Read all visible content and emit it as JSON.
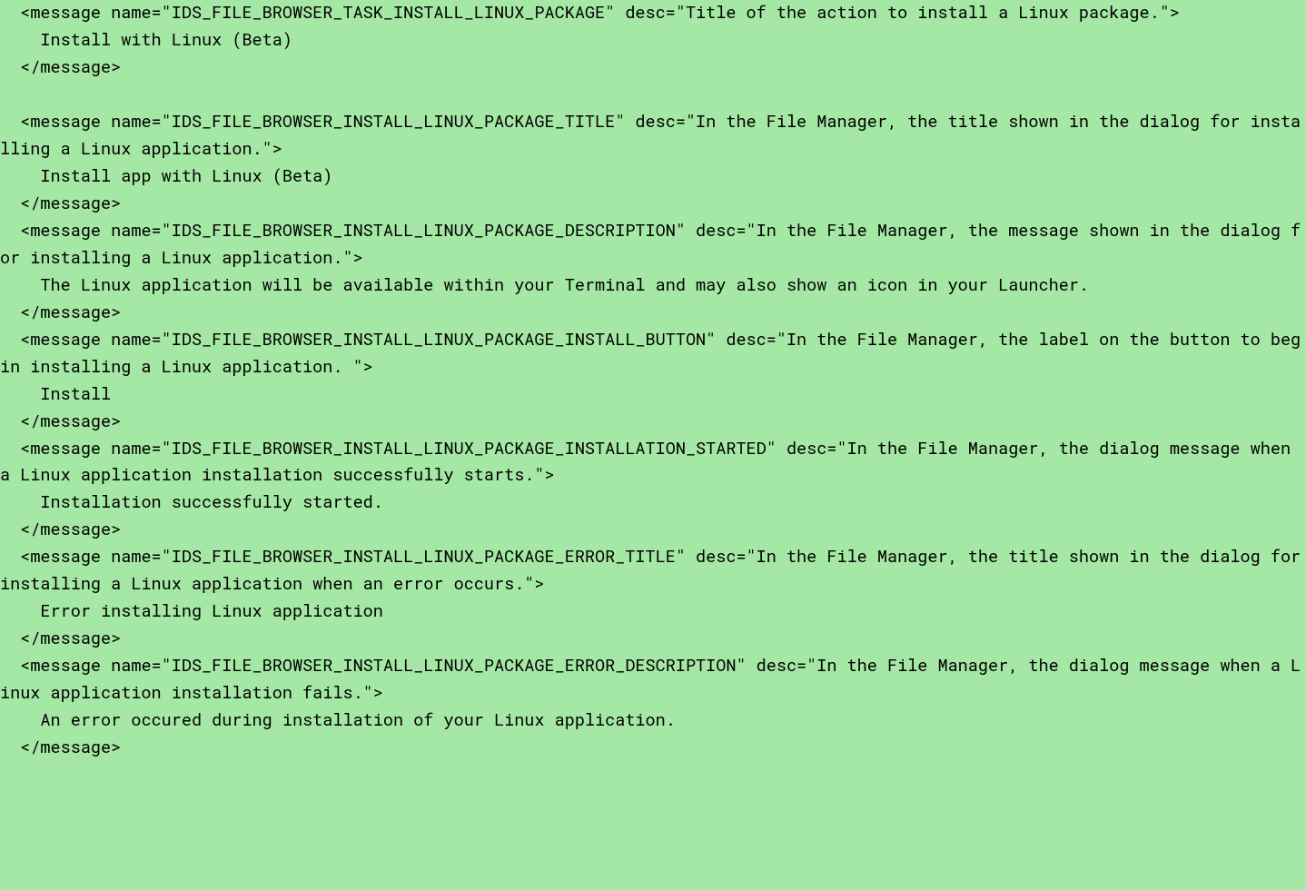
{
  "messages": [
    {
      "open": "  <message name=\"IDS_FILE_BROWSER_TASK_INSTALL_LINUX_PACKAGE\" desc=\"Title of the action to install a Linux package.\">",
      "body": "    Install with Linux (Beta)",
      "close": "  </message>"
    },
    {
      "open": "  <message name=\"IDS_FILE_BROWSER_INSTALL_LINUX_PACKAGE_TITLE\" desc=\"In the File Manager, the title shown in the dialog for installing a Linux application.\">",
      "body": "    Install app with Linux (Beta)",
      "close": "  </message>"
    },
    {
      "open": "  <message name=\"IDS_FILE_BROWSER_INSTALL_LINUX_PACKAGE_DESCRIPTION\" desc=\"In the File Manager, the message shown in the dialog for installing a Linux application.\">",
      "body": "    The Linux application will be available within your Terminal and may also show an icon in your Launcher.",
      "close": "  </message>"
    },
    {
      "open": "  <message name=\"IDS_FILE_BROWSER_INSTALL_LINUX_PACKAGE_INSTALL_BUTTON\" desc=\"In the File Manager, the label on the button to begin installing a Linux application. \">",
      "body": "    Install",
      "close": "  </message>"
    },
    {
      "open": "  <message name=\"IDS_FILE_BROWSER_INSTALL_LINUX_PACKAGE_INSTALLATION_STARTED\" desc=\"In the File Manager, the dialog message when a Linux application installation successfully starts.\">",
      "body": "    Installation successfully started.",
      "close": "  </message>"
    },
    {
      "open": "  <message name=\"IDS_FILE_BROWSER_INSTALL_LINUX_PACKAGE_ERROR_TITLE\" desc=\"In the File Manager, the title shown in the dialog for installing a Linux application when an error occurs.\">",
      "body": "    Error installing Linux application",
      "close": "  </message>"
    },
    {
      "open": "  <message name=\"IDS_FILE_BROWSER_INSTALL_LINUX_PACKAGE_ERROR_DESCRIPTION\" desc=\"In the File Manager, the dialog message when a Linux application installation fails.\">",
      "body": "    An error occured during installation of your Linux application.",
      "close": "  </message>"
    }
  ]
}
